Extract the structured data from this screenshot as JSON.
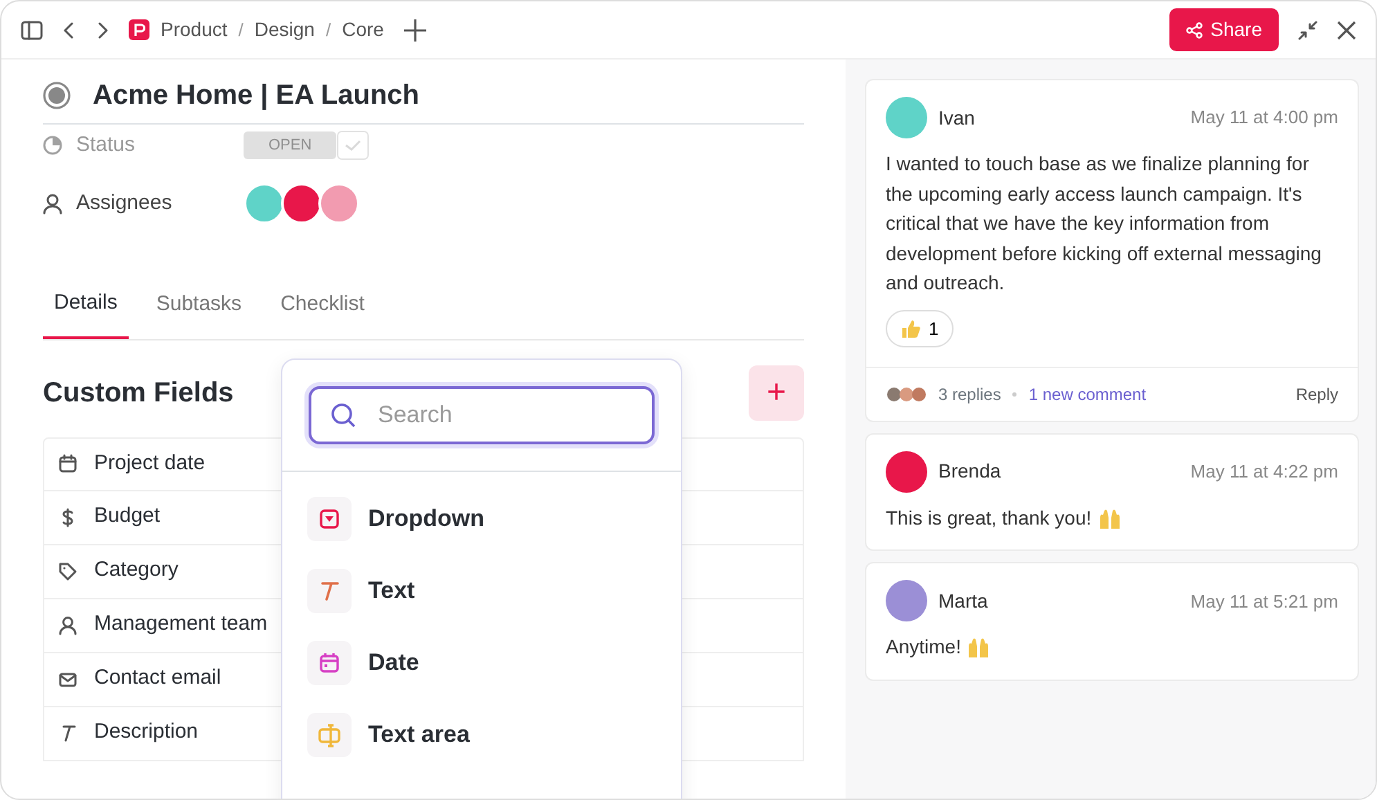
{
  "breadcrumb": [
    {
      "kind": "link",
      "label": "Product"
    },
    {
      "kind": "separator",
      "label": "/"
    },
    {
      "kind": "link",
      "label": "Design"
    },
    {
      "kind": "separator",
      "label": "/"
    },
    {
      "kind": "link",
      "label": "Core"
    }
  ],
  "share_button": "Share",
  "task": {
    "title": "Acme Home | EA Launch",
    "status_label": "Status",
    "status_value": "OPEN",
    "assignees_label": "Assignees",
    "assignees": [
      {
        "color": "#5fd3c8"
      },
      {
        "color": "#e8174a"
      },
      {
        "color": "#f29bb0"
      }
    ]
  },
  "tabs": [
    {
      "label": "Details",
      "selected": true
    },
    {
      "label": "Subtasks",
      "selected": false
    },
    {
      "label": "Checklist",
      "selected": false
    }
  ],
  "custom_fields": {
    "title": "Custom Fields",
    "add_button": "+",
    "fields": [
      {
        "kind": "date",
        "label": "Project date"
      },
      {
        "kind": "money",
        "label": "Budget"
      },
      {
        "kind": "tag",
        "label": "Category"
      },
      {
        "kind": "person",
        "label": "Management team"
      },
      {
        "kind": "email",
        "label": "Contact email"
      },
      {
        "kind": "text",
        "label": "Description"
      }
    ]
  },
  "field_menu": {
    "placeholder": "Search",
    "items": [
      {
        "kind": "dropdown",
        "label": "Dropdown"
      },
      {
        "kind": "text",
        "label": "Text"
      },
      {
        "kind": "date",
        "label": "Date"
      },
      {
        "kind": "textarea",
        "label": "Text area"
      }
    ]
  },
  "comments": [
    {
      "author": "Ivan",
      "color": "#5fd3c8",
      "time": "May 11 at 4:00 pm",
      "text": "I wanted to touch base as we finalize planning for the upcoming early access launch campaign. It's critical that we have the key information from development before kicking off external messaging and outreach.",
      "raised_hands": false,
      "reaction": {
        "count": "1"
      },
      "footer": {
        "replies": "3 replies",
        "new": "1 new comment",
        "reply": "Reply"
      }
    },
    {
      "author": "Brenda",
      "color": "#e8174a",
      "time": "May 11 at 4:22 pm",
      "text": "This is great, thank you!",
      "raised_hands": true
    },
    {
      "author": "Marta",
      "color": "#9b8fd6",
      "time": "May 11 at 5:21 pm",
      "text": "Anytime!",
      "raised_hands": true
    }
  ]
}
